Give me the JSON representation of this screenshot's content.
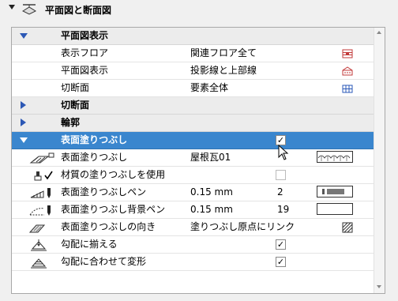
{
  "header": {
    "title": "平面図と断面図"
  },
  "rows": [
    {
      "label": "平面図表示"
    },
    {
      "label": "表示フロア",
      "value": "関連フロア全て"
    },
    {
      "label": "平面図表示",
      "value": "投影線と上部線"
    },
    {
      "label": "切断面",
      "value": "要素全体"
    },
    {
      "label": "切断面"
    },
    {
      "label": "輪郭"
    },
    {
      "label": "表面塗りつぶし",
      "checked": true
    },
    {
      "label": "表面塗りつぶし",
      "value": "屋根瓦01"
    },
    {
      "label": "材質の塗りつぶしを使用",
      "checked": false
    },
    {
      "label": "表面塗りつぶしペン",
      "value": "0.15 mm",
      "num": "2"
    },
    {
      "label": "表面塗りつぶし背景ペン",
      "value": "0.15 mm",
      "num": "19"
    },
    {
      "label": "表面塗りつぶしの向き",
      "value": "塗りつぶし原点にリンク"
    },
    {
      "label": "勾配に揃える",
      "checked": true
    },
    {
      "label": "勾配に合わせて変形",
      "checked": true
    }
  ],
  "colors": {
    "selection": "#3a86ce",
    "group_bg": "#ececec",
    "accent": "#2c58b5",
    "icon_red": "#c23a3a",
    "icon_blue": "#2b58b8"
  }
}
